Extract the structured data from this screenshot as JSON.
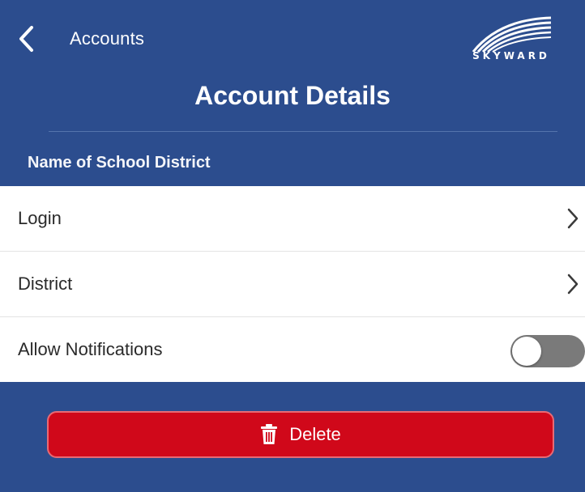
{
  "nav": {
    "back_label": "Accounts",
    "back_icon": "chevron-left-icon",
    "logo_text": "SKYWARD"
  },
  "page": {
    "title": "Account Details",
    "section_label": "Name of School District"
  },
  "settings": {
    "rows": [
      {
        "label": "Login",
        "accessory": "chevron-right-icon"
      },
      {
        "label": "District",
        "accessory": "chevron-right-icon"
      },
      {
        "label": "Allow Notifications",
        "accessory": "toggle",
        "toggle_on": false
      }
    ]
  },
  "actions": {
    "delete_label": "Delete",
    "delete_icon": "trash-icon"
  },
  "colors": {
    "header_bg": "#2c4d8e",
    "delete_bg": "#d0081a",
    "toggle_off": "#7a7a7a"
  }
}
